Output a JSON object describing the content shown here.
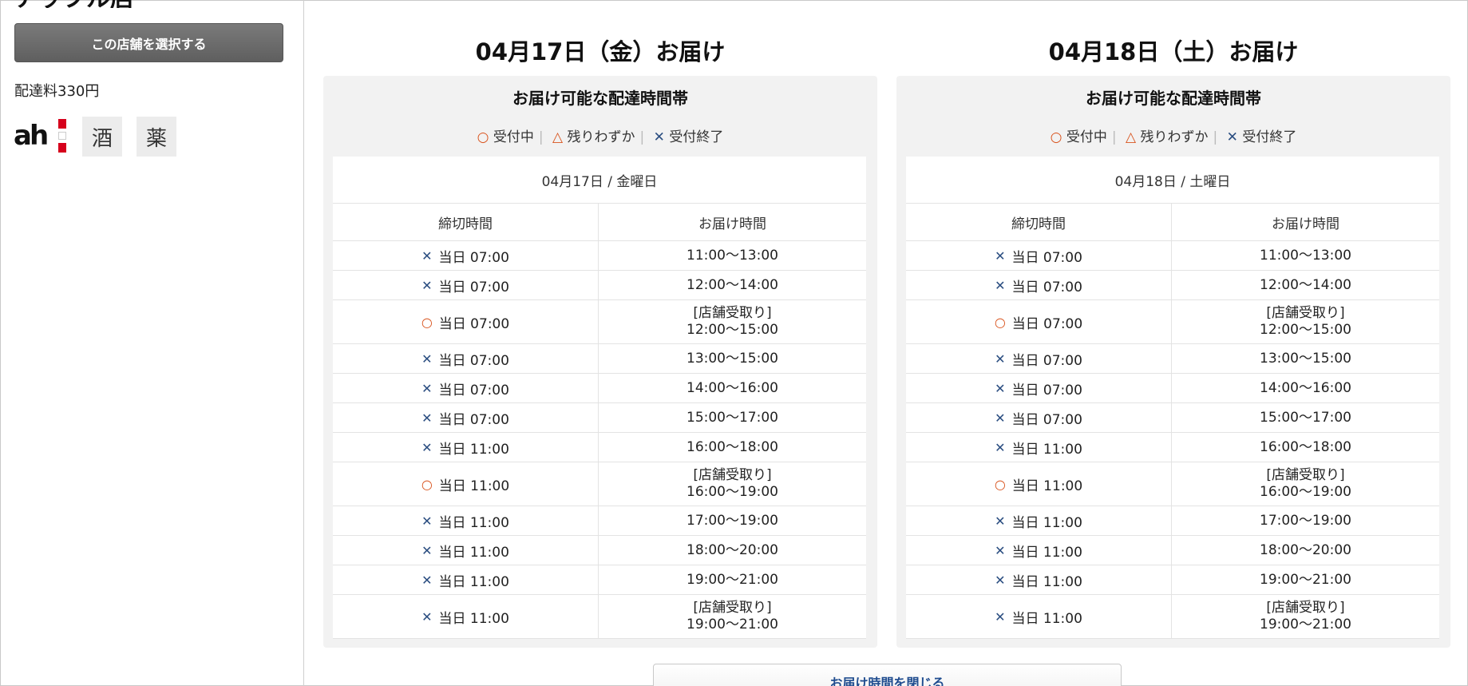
{
  "store": {
    "name": "アップル店",
    "select_button": "この店舗を選択する",
    "delivery_fee": "配達料330円",
    "service_tags": [
      "酒",
      "薬"
    ]
  },
  "legend": {
    "open_symbol": "○",
    "open_label": "受付中",
    "few_symbol": "△",
    "few_label": "残りわずか",
    "closed_symbol": "✕",
    "closed_label": "受付終了"
  },
  "panel_title": "お届け可能な配達時間帯",
  "columns": {
    "deadline": "締切時間",
    "delivery": "お届け時間"
  },
  "days": [
    {
      "title": "04月17日（金）お届け",
      "date_label": "04月17日 / 金曜日",
      "rows": [
        {
          "mark": "✕",
          "status": "closed",
          "deadline": "当日 07:00",
          "pickup": "",
          "time": "11:00〜13:00"
        },
        {
          "mark": "✕",
          "status": "closed",
          "deadline": "当日 07:00",
          "pickup": "",
          "time": "12:00〜14:00"
        },
        {
          "mark": "○",
          "status": "open",
          "deadline": "当日 07:00",
          "pickup": "[店舗受取り]",
          "time": "12:00〜15:00"
        },
        {
          "mark": "✕",
          "status": "closed",
          "deadline": "当日 07:00",
          "pickup": "",
          "time": "13:00〜15:00"
        },
        {
          "mark": "✕",
          "status": "closed",
          "deadline": "当日 07:00",
          "pickup": "",
          "time": "14:00〜16:00"
        },
        {
          "mark": "✕",
          "status": "closed",
          "deadline": "当日 07:00",
          "pickup": "",
          "time": "15:00〜17:00"
        },
        {
          "mark": "✕",
          "status": "closed",
          "deadline": "当日 11:00",
          "pickup": "",
          "time": "16:00〜18:00"
        },
        {
          "mark": "○",
          "status": "open",
          "deadline": "当日 11:00",
          "pickup": "[店舗受取り]",
          "time": "16:00〜19:00"
        },
        {
          "mark": "✕",
          "status": "closed",
          "deadline": "当日 11:00",
          "pickup": "",
          "time": "17:00〜19:00"
        },
        {
          "mark": "✕",
          "status": "closed",
          "deadline": "当日 11:00",
          "pickup": "",
          "time": "18:00〜20:00"
        },
        {
          "mark": "✕",
          "status": "closed",
          "deadline": "当日 11:00",
          "pickup": "",
          "time": "19:00〜21:00"
        },
        {
          "mark": "✕",
          "status": "closed",
          "deadline": "当日 11:00",
          "pickup": "[店舗受取り]",
          "time": "19:00〜21:00"
        }
      ]
    },
    {
      "title": "04月18日（土）お届け",
      "date_label": "04月18日 / 土曜日",
      "rows": [
        {
          "mark": "✕",
          "status": "closed",
          "deadline": "当日 07:00",
          "pickup": "",
          "time": "11:00〜13:00"
        },
        {
          "mark": "✕",
          "status": "closed",
          "deadline": "当日 07:00",
          "pickup": "",
          "time": "12:00〜14:00"
        },
        {
          "mark": "○",
          "status": "open",
          "deadline": "当日 07:00",
          "pickup": "[店舗受取り]",
          "time": "12:00〜15:00"
        },
        {
          "mark": "✕",
          "status": "closed",
          "deadline": "当日 07:00",
          "pickup": "",
          "time": "13:00〜15:00"
        },
        {
          "mark": "✕",
          "status": "closed",
          "deadline": "当日 07:00",
          "pickup": "",
          "time": "14:00〜16:00"
        },
        {
          "mark": "✕",
          "status": "closed",
          "deadline": "当日 07:00",
          "pickup": "",
          "time": "15:00〜17:00"
        },
        {
          "mark": "✕",
          "status": "closed",
          "deadline": "当日 11:00",
          "pickup": "",
          "time": "16:00〜18:00"
        },
        {
          "mark": "○",
          "status": "open",
          "deadline": "当日 11:00",
          "pickup": "[店舗受取り]",
          "time": "16:00〜19:00"
        },
        {
          "mark": "✕",
          "status": "closed",
          "deadline": "当日 11:00",
          "pickup": "",
          "time": "17:00〜19:00"
        },
        {
          "mark": "✕",
          "status": "closed",
          "deadline": "当日 11:00",
          "pickup": "",
          "time": "18:00〜20:00"
        },
        {
          "mark": "✕",
          "status": "closed",
          "deadline": "当日 11:00",
          "pickup": "",
          "time": "19:00〜21:00"
        },
        {
          "mark": "✕",
          "status": "closed",
          "deadline": "当日 11:00",
          "pickup": "[店舗受取り]",
          "time": "19:00〜21:00"
        }
      ]
    }
  ],
  "close_button": "お届け時間を閉じる",
  "colors": {
    "open": "#d9541e",
    "closed": "#2a4d80",
    "panel_bg": "#f2f2f2",
    "button_gray": "#6b6b6b"
  }
}
